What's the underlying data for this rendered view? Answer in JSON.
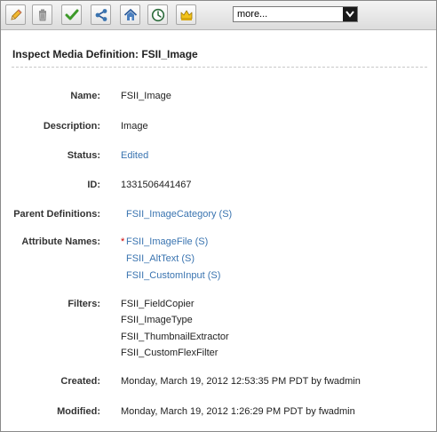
{
  "toolbar": {
    "buttons": [
      {
        "icon": "pencil-icon",
        "title": "Edit"
      },
      {
        "icon": "trash-icon",
        "title": "Delete"
      },
      {
        "icon": "checkmark-icon",
        "title": "Approve"
      },
      {
        "icon": "share-icon",
        "title": "Share"
      },
      {
        "icon": "home-icon",
        "title": "Home"
      },
      {
        "icon": "clock-icon",
        "title": "History"
      },
      {
        "icon": "crown-icon",
        "title": "Status"
      }
    ],
    "more_select": {
      "selected": "more..."
    }
  },
  "page": {
    "title": "Inspect Media Definition: FSII_Image"
  },
  "fields": {
    "name": {
      "label": "Name:",
      "value": "FSII_Image"
    },
    "description": {
      "label": "Description:",
      "value": "Image"
    },
    "status": {
      "label": "Status:",
      "value": "Edited"
    },
    "id": {
      "label": "ID:",
      "value": "1331506441467"
    },
    "parent_definitions": {
      "label": "Parent Definitions:",
      "value": "FSII_ImageCategory (S)"
    },
    "attribute_names": {
      "label": "Attribute Names:",
      "required_marker": "*",
      "items": [
        "FSII_ImageFile (S)",
        "FSII_AltText (S)",
        "FSII_CustomInput (S)"
      ]
    },
    "filters": {
      "label": "Filters:",
      "items": [
        "FSII_FieldCopier",
        "FSII_ImageType",
        "FSII_ThumbnailExtractor",
        "FSII_CustomFlexFilter"
      ]
    },
    "created": {
      "label": "Created:",
      "value": "Monday, March 19, 2012 12:53:35 PM PDT by fwadmin"
    },
    "modified": {
      "label": "Modified:",
      "value": "Monday, March 19, 2012 1:26:29 PM PDT by fwadmin"
    }
  },
  "colors": {
    "link": "#3a74b0",
    "required": "#cc0000"
  }
}
